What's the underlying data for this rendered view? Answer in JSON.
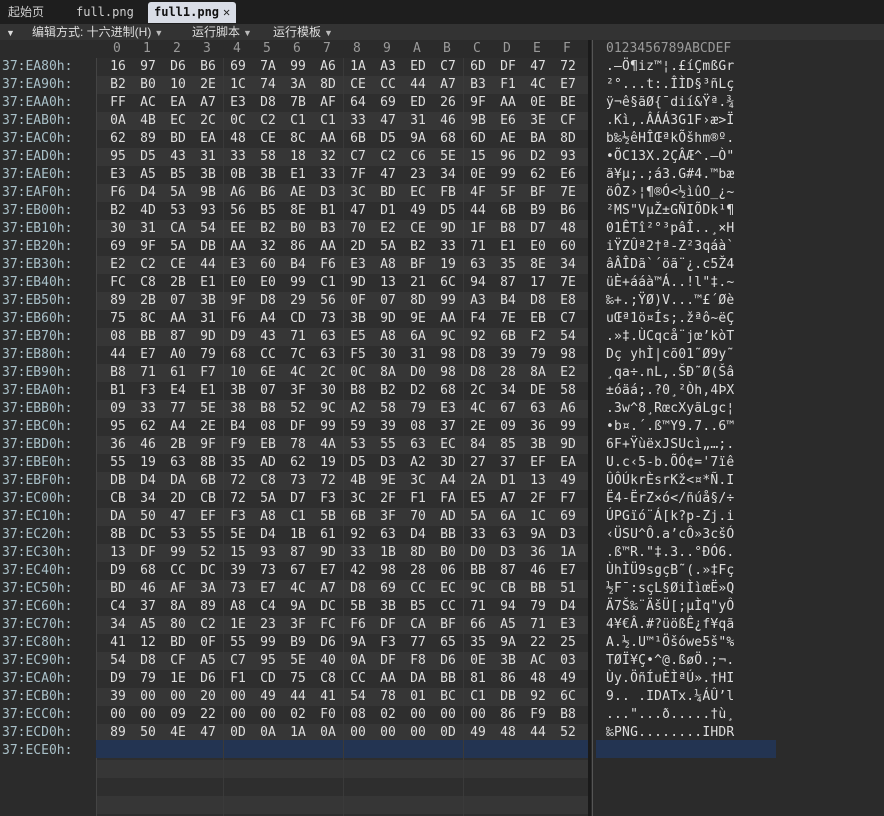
{
  "tabs": [
    {
      "label": "起始页",
      "active": false
    },
    {
      "label": "full.png",
      "active": false
    },
    {
      "label": "full1.png",
      "active": true
    }
  ],
  "toolbar": {
    "collapse_glyph": "▼",
    "edit_mode": "编辑方式: 十六进制(H)",
    "run_script": "运行脚本",
    "run_template": "运行模板"
  },
  "header": {
    "hex_columns": [
      "0",
      "1",
      "2",
      "3",
      "4",
      "5",
      "6",
      "7",
      "8",
      "9",
      "A",
      "B",
      "C",
      "D",
      "E",
      "F"
    ],
    "ascii_header": "0123456789ABCDEF"
  },
  "rows": [
    {
      "addr": "37:EA80h:",
      "hex": [
        "16",
        "97",
        "D6",
        "B6",
        "69",
        "7A",
        "99",
        "A6",
        "1A",
        "A3",
        "ED",
        "C7",
        "6D",
        "DF",
        "47",
        "72"
      ],
      "ascii": ".—Ö¶iz™¦.£íÇmßGr"
    },
    {
      "addr": "37:EA90h:",
      "hex": [
        "B2",
        "B0",
        "10",
        "2E",
        "1C",
        "74",
        "3A",
        "8D",
        "CE",
        "CC",
        "44",
        "A7",
        "B3",
        "F1",
        "4C",
        "E7"
      ],
      "ascii": "²°...t:.ÎÌD§³ñLç"
    },
    {
      "addr": "37:EAA0h:",
      "hex": [
        "FF",
        "AC",
        "EA",
        "A7",
        "E3",
        "D8",
        "7B",
        "AF",
        "64",
        "69",
        "ED",
        "26",
        "9F",
        "AA",
        "0E",
        "BE"
      ],
      "ascii": "ÿ¬ê§ãØ{¯dií&Ÿª.¾"
    },
    {
      "addr": "37:EAB0h:",
      "hex": [
        "0A",
        "4B",
        "EC",
        "2C",
        "0C",
        "C2",
        "C1",
        "C1",
        "33",
        "47",
        "31",
        "46",
        "9B",
        "E6",
        "3E",
        "CF"
      ],
      "ascii": ".Kì,.ÂÁÁ3G1F›æ>Ï"
    },
    {
      "addr": "37:EAC0h:",
      "hex": [
        "62",
        "89",
        "BD",
        "EA",
        "48",
        "CE",
        "8C",
        "AA",
        "6B",
        "D5",
        "9A",
        "68",
        "6D",
        "AE",
        "BA",
        "8D"
      ],
      "ascii": "b‰½êHÎŒªkÕšhm®º."
    },
    {
      "addr": "37:EAD0h:",
      "hex": [
        "95",
        "D5",
        "43",
        "31",
        "33",
        "58",
        "18",
        "32",
        "C7",
        "C2",
        "C6",
        "5E",
        "15",
        "96",
        "D2",
        "93"
      ],
      "ascii": "•ÕC13X.2ÇÂÆ^.–Ò\""
    },
    {
      "addr": "37:EAE0h:",
      "hex": [
        "E3",
        "A5",
        "B5",
        "3B",
        "0B",
        "3B",
        "E1",
        "33",
        "7F",
        "47",
        "23",
        "34",
        "0E",
        "99",
        "62",
        "E6"
      ],
      "ascii": "ã¥µ;.;á3.G#4.™bæ"
    },
    {
      "addr": "37:EAF0h:",
      "hex": [
        "F6",
        "D4",
        "5A",
        "9B",
        "A6",
        "B6",
        "AE",
        "D3",
        "3C",
        "BD",
        "EC",
        "FB",
        "4F",
        "5F",
        "BF",
        "7E"
      ],
      "ascii": "öÔZ›¦¶®Ó<½ìûO_¿~"
    },
    {
      "addr": "37:EB00h:",
      "hex": [
        "B2",
        "4D",
        "53",
        "93",
        "56",
        "B5",
        "8E",
        "B1",
        "47",
        "D1",
        "49",
        "D5",
        "44",
        "6B",
        "B9",
        "B6"
      ],
      "ascii": "²MS\"VµŽ±GÑIÕDk¹¶"
    },
    {
      "addr": "37:EB10h:",
      "hex": [
        "30",
        "31",
        "CA",
        "54",
        "EE",
        "B2",
        "B0",
        "B3",
        "70",
        "E2",
        "CE",
        "9D",
        "1F",
        "B8",
        "D7",
        "48"
      ],
      "ascii": "01ÊTî²°³pâÎ..¸×H"
    },
    {
      "addr": "37:EB20h:",
      "hex": [
        "69",
        "9F",
        "5A",
        "DB",
        "AA",
        "32",
        "86",
        "AA",
        "2D",
        "5A",
        "B2",
        "33",
        "71",
        "E1",
        "E0",
        "60"
      ],
      "ascii": "iŸZÛª2†ª-Z²3qáà`"
    },
    {
      "addr": "37:EB30h:",
      "hex": [
        "E2",
        "C2",
        "CE",
        "44",
        "E3",
        "60",
        "B4",
        "F6",
        "E3",
        "A8",
        "BF",
        "19",
        "63",
        "35",
        "8E",
        "34"
      ],
      "ascii": "âÂÎDã`´öã¨¿.c5Ž4"
    },
    {
      "addr": "37:EB40h:",
      "hex": [
        "FC",
        "C8",
        "2B",
        "E1",
        "E0",
        "E0",
        "99",
        "C1",
        "9D",
        "13",
        "21",
        "6C",
        "94",
        "87",
        "17",
        "7E"
      ],
      "ascii": "üÈ+ááà™Á..!l\"‡.~"
    },
    {
      "addr": "37:EB50h:",
      "hex": [
        "89",
        "2B",
        "07",
        "3B",
        "9F",
        "D8",
        "29",
        "56",
        "0F",
        "07",
        "8D",
        "99",
        "A3",
        "B4",
        "D8",
        "E8"
      ],
      "ascii": "‰+.;ŸØ)V...™£´Øè"
    },
    {
      "addr": "37:EB60h:",
      "hex": [
        "75",
        "8C",
        "AA",
        "31",
        "F6",
        "A4",
        "CD",
        "73",
        "3B",
        "9D",
        "9E",
        "AA",
        "F4",
        "7E",
        "EB",
        "C7"
      ],
      "ascii": "uŒª1ö¤Ís;.žªô~ëÇ"
    },
    {
      "addr": "37:EB70h:",
      "hex": [
        "08",
        "BB",
        "87",
        "9D",
        "D9",
        "43",
        "71",
        "63",
        "E5",
        "A8",
        "6A",
        "9C",
        "92",
        "6B",
        "F2",
        "54"
      ],
      "ascii": ".»‡.ÙCqcå¨jœ’kòT"
    },
    {
      "addr": "37:EB80h:",
      "hex": [
        "44",
        "E7",
        "A0",
        "79",
        "68",
        "CC",
        "7C",
        "63",
        "F5",
        "30",
        "31",
        "98",
        "D8",
        "39",
        "79",
        "98"
      ],
      "ascii": "Dç yhÌ|cõ01˜Ø9y˜"
    },
    {
      "addr": "37:EB90h:",
      "hex": [
        "B8",
        "71",
        "61",
        "F7",
        "10",
        "6E",
        "4C",
        "2C",
        "0C",
        "8A",
        "D0",
        "98",
        "D8",
        "28",
        "8A",
        "E2"
      ],
      "ascii": "¸qa÷.nL,.ŠÐ˜Ø(Šâ"
    },
    {
      "addr": "37:EBA0h:",
      "hex": [
        "B1",
        "F3",
        "E4",
        "E1",
        "3B",
        "07",
        "3F",
        "30",
        "B8",
        "B2",
        "D2",
        "68",
        "2C",
        "34",
        "DE",
        "58"
      ],
      "ascii": "±óäá;.?0¸²Òh,4ÞX"
    },
    {
      "addr": "37:EBB0h:",
      "hex": [
        "09",
        "33",
        "77",
        "5E",
        "38",
        "B8",
        "52",
        "9C",
        "A2",
        "58",
        "79",
        "E3",
        "4C",
        "67",
        "63",
        "A6"
      ],
      "ascii": ".3w^8¸RœcXyãLgc¦"
    },
    {
      "addr": "37:EBC0h:",
      "hex": [
        "95",
        "62",
        "A4",
        "2E",
        "B4",
        "08",
        "DF",
        "99",
        "59",
        "39",
        "08",
        "37",
        "2E",
        "09",
        "36",
        "99"
      ],
      "ascii": "•b¤.´.ß™Y9.7..6™"
    },
    {
      "addr": "37:EBD0h:",
      "hex": [
        "36",
        "46",
        "2B",
        "9F",
        "F9",
        "EB",
        "78",
        "4A",
        "53",
        "55",
        "63",
        "EC",
        "84",
        "85",
        "3B",
        "9D"
      ],
      "ascii": "6F+ŸùëxJSUcì„…;."
    },
    {
      "addr": "37:EBE0h:",
      "hex": [
        "55",
        "19",
        "63",
        "8B",
        "35",
        "AD",
        "62",
        "19",
        "D5",
        "D3",
        "A2",
        "3D",
        "27",
        "37",
        "EF",
        "EA"
      ],
      "ascii": "U.c‹5-b.ÕÓ¢='7ïê"
    },
    {
      "addr": "37:EBF0h:",
      "hex": [
        "DB",
        "D4",
        "DA",
        "6B",
        "72",
        "C8",
        "73",
        "72",
        "4B",
        "9E",
        "3C",
        "A4",
        "2A",
        "D1",
        "13",
        "49"
      ],
      "ascii": "ÛÔÚkrÈsrKž<¤*Ñ.I"
    },
    {
      "addr": "37:EC00h:",
      "hex": [
        "CB",
        "34",
        "2D",
        "CB",
        "72",
        "5A",
        "D7",
        "F3",
        "3C",
        "2F",
        "F1",
        "FA",
        "E5",
        "A7",
        "2F",
        "F7"
      ],
      "ascii": "Ë4-ËrZ×ó</ñúå§/÷"
    },
    {
      "addr": "37:EC10h:",
      "hex": [
        "DA",
        "50",
        "47",
        "EF",
        "F3",
        "A8",
        "C1",
        "5B",
        "6B",
        "3F",
        "70",
        "AD",
        "5A",
        "6A",
        "1C",
        "69"
      ],
      "ascii": "ÚPGïó¨Á[k?p-Zj.i"
    },
    {
      "addr": "37:EC20h:",
      "hex": [
        "8B",
        "DC",
        "53",
        "55",
        "5E",
        "D4",
        "1B",
        "61",
        "92",
        "63",
        "D4",
        "BB",
        "33",
        "63",
        "9A",
        "D3"
      ],
      "ascii": "‹ÜSU^Ô.a’cÔ»3cšÓ"
    },
    {
      "addr": "37:EC30h:",
      "hex": [
        "13",
        "DF",
        "99",
        "52",
        "15",
        "93",
        "87",
        "9D",
        "33",
        "1B",
        "8D",
        "B0",
        "D0",
        "D3",
        "36",
        "1A"
      ],
      "ascii": ".ß™R.\"‡.3..°ÐÓ6."
    },
    {
      "addr": "37:EC40h:",
      "hex": [
        "D9",
        "68",
        "CC",
        "DC",
        "39",
        "73",
        "67",
        "E7",
        "42",
        "98",
        "28",
        "06",
        "BB",
        "87",
        "46",
        "E7"
      ],
      "ascii": "ÙhÌÜ9sgçB˜(.»‡Fç"
    },
    {
      "addr": "37:EC50h:",
      "hex": [
        "BD",
        "46",
        "AF",
        "3A",
        "73",
        "E7",
        "4C",
        "A7",
        "D8",
        "69",
        "CC",
        "EC",
        "9C",
        "CB",
        "BB",
        "51"
      ],
      "ascii": "½F¯:sçL§ØiÌìœË»Q"
    },
    {
      "addr": "37:EC60h:",
      "hex": [
        "C4",
        "37",
        "8A",
        "89",
        "A8",
        "C4",
        "9A",
        "DC",
        "5B",
        "3B",
        "B5",
        "CC",
        "71",
        "94",
        "79",
        "D4"
      ],
      "ascii": "Ä7Š‰¨ÄšÜ[;µÌq\"yÔ"
    },
    {
      "addr": "37:EC70h:",
      "hex": [
        "34",
        "A5",
        "80",
        "C2",
        "1E",
        "23",
        "3F",
        "FC",
        "F6",
        "DF",
        "CA",
        "BF",
        "66",
        "A5",
        "71",
        "E3"
      ],
      "ascii": "4¥€Â.#?üößÊ¿f¥qã"
    },
    {
      "addr": "37:EC80h:",
      "hex": [
        "41",
        "12",
        "BD",
        "0F",
        "55",
        "99",
        "B9",
        "D6",
        "9A",
        "F3",
        "77",
        "65",
        "35",
        "9A",
        "22",
        "25"
      ],
      "ascii": "A.½.U™¹Öšówe5š\"%"
    },
    {
      "addr": "37:EC90h:",
      "hex": [
        "54",
        "D8",
        "CF",
        "A5",
        "C7",
        "95",
        "5E",
        "40",
        "0A",
        "DF",
        "F8",
        "D6",
        "0E",
        "3B",
        "AC",
        "03"
      ],
      "ascii": "TØÏ¥Ç•^@.ßøÖ.;¬."
    },
    {
      "addr": "37:ECA0h:",
      "hex": [
        "D9",
        "79",
        "1E",
        "D6",
        "F1",
        "CD",
        "75",
        "C8",
        "CC",
        "AA",
        "DA",
        "BB",
        "81",
        "86",
        "48",
        "49"
      ],
      "ascii": "Ùy.ÖñÍuÈÌªÚ».†HI"
    },
    {
      "addr": "37:ECB0h:",
      "hex": [
        "39",
        "00",
        "00",
        "20",
        "00",
        "49",
        "44",
        "41",
        "54",
        "78",
        "01",
        "BC",
        "C1",
        "DB",
        "92",
        "6C"
      ],
      "ascii": "9.. .IDATx.¼ÁÛ’l"
    },
    {
      "addr": "37:ECC0h:",
      "hex": [
        "00",
        "00",
        "09",
        "22",
        "00",
        "00",
        "02",
        "F0",
        "08",
        "02",
        "00",
        "00",
        "00",
        "86",
        "F9",
        "B8"
      ],
      "ascii": "...\"...ð.....†ù¸"
    },
    {
      "addr": "37:ECD0h:",
      "hex": [
        "89",
        "50",
        "4E",
        "47",
        "0D",
        "0A",
        "1A",
        "0A",
        "00",
        "00",
        "00",
        "0D",
        "49",
        "48",
        "44",
        "52"
      ],
      "ascii": "‰PNG........IHDR"
    },
    {
      "addr": "37:ECE0h:",
      "hex": [],
      "ascii": ""
    }
  ]
}
